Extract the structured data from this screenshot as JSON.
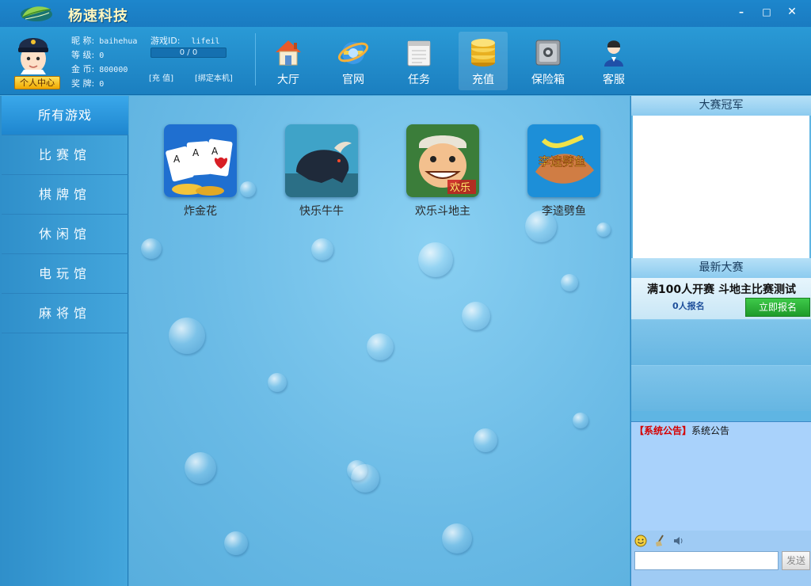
{
  "app": {
    "title": "杨速科技"
  },
  "window_controls": {
    "minimize": "–",
    "maximize": "□",
    "close": "✕"
  },
  "user": {
    "nickname_label": "昵 称:",
    "nickname": "baihehua",
    "game_id_label": "游戏ID:",
    "game_id": "lifeil",
    "level_label": "等 级:",
    "level": "0",
    "gold_label": "金 币:",
    "gold": "800000",
    "medal_label": "奖 牌:",
    "medal": "0",
    "exp_text": "0 / 0",
    "exp_progress": 0,
    "recharge_link": "[充 值]",
    "bind_link": "[绑定本机]",
    "profile_button": "个人中心"
  },
  "nav": [
    {
      "label": "大厅",
      "icon": "home-icon"
    },
    {
      "label": "官网",
      "icon": "browser-icon"
    },
    {
      "label": "任务",
      "icon": "notepad-icon"
    },
    {
      "label": "充值",
      "icon": "coins-icon",
      "active": true
    },
    {
      "label": "保险箱",
      "icon": "safe-icon"
    },
    {
      "label": "客服",
      "icon": "service-agent-icon"
    }
  ],
  "sidebar": {
    "items": [
      {
        "label": "所有游戏",
        "active": true
      },
      {
        "label": "比赛馆"
      },
      {
        "label": "棋牌馆"
      },
      {
        "label": "休闲馆"
      },
      {
        "label": "电玩馆"
      },
      {
        "label": "麻将馆"
      }
    ]
  },
  "games": [
    {
      "label": "炸金花",
      "icon": "poker-cards-icon"
    },
    {
      "label": "快乐牛牛",
      "icon": "bull-icon"
    },
    {
      "label": "欢乐斗地主",
      "icon": "landlord-face-icon",
      "badge": "欢乐"
    },
    {
      "label": "李逵劈鱼",
      "icon": "fish-game-icon",
      "badge": "李逵劈鱼"
    }
  ],
  "right_panel": {
    "champion_title": "大赛冠军",
    "latest_title": "最新大赛",
    "match": {
      "title": "满100人开赛 斗地主比赛测试",
      "count": "0人报名",
      "signup_button": "立即报名"
    },
    "notice": {
      "tag": "【系统公告】",
      "text": "系统公告"
    },
    "chat": {
      "input_value": "",
      "send_button": "发送"
    }
  },
  "colors": {
    "accent_blue": "#1d86cc",
    "signup_green": "#2db33a",
    "notice_red": "#d60000",
    "profile_yellow": "#f0a800"
  }
}
